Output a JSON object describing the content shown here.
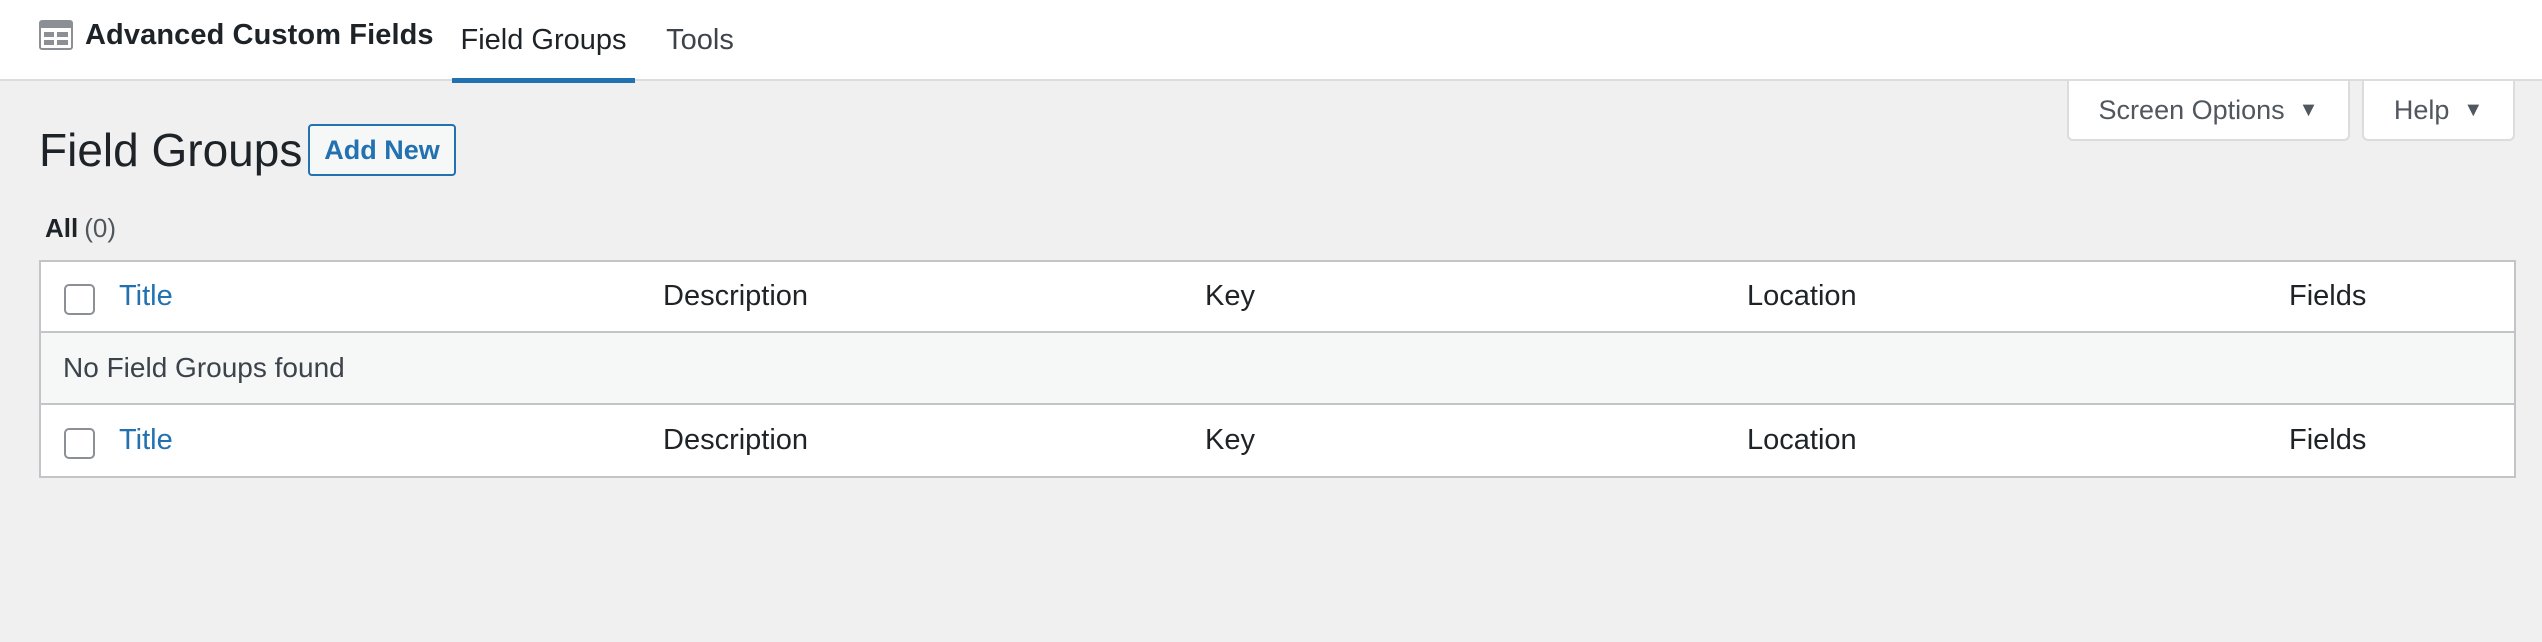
{
  "header": {
    "app_title": "Advanced Custom Fields",
    "app_icon": "acf-table-icon",
    "tabs": [
      {
        "label": "Field Groups",
        "active": true
      },
      {
        "label": "Tools",
        "active": false
      }
    ]
  },
  "screen_meta": {
    "screen_options_label": "Screen Options",
    "help_label": "Help",
    "caret_glyph": "▼"
  },
  "page": {
    "title": "Field Groups",
    "add_new_label": "Add New"
  },
  "filters": {
    "all_label": "All",
    "all_count": "(0)"
  },
  "table": {
    "columns": [
      "Title",
      "Description",
      "Key",
      "Location",
      "Fields"
    ],
    "empty_message": "No Field Groups found"
  },
  "colors": {
    "accent": "#2271b1",
    "background": "#f0f0f1",
    "border": "#c3c4c7"
  }
}
